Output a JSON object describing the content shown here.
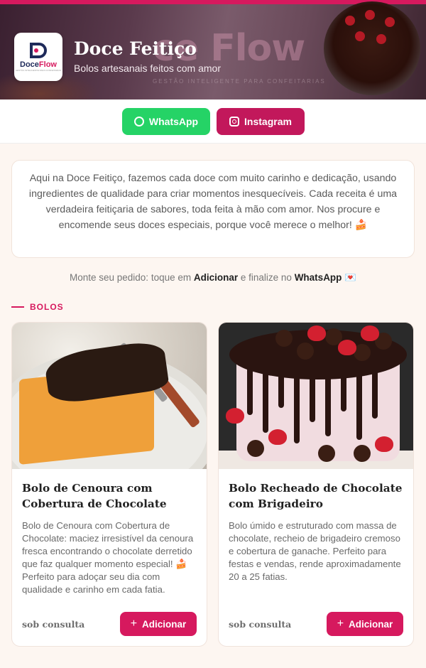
{
  "header": {
    "banner_watermark": "ce Flow",
    "banner_tagline": "GESTÃO INTELIGENTE PARA CONFEITARIAS",
    "logo_text_a": "Doce",
    "logo_text_b": "Flow",
    "logo_subtext": "GESTÃO INTELIGENTE PARA CONFEITARIAS",
    "brand_name": "Doce Feitiço",
    "brand_tagline": "Bolos artesanais feitos com amor"
  },
  "social": {
    "whatsapp_label": "WhatsApp",
    "instagram_label": "Instagram",
    "colors": {
      "whatsapp": "#25d366",
      "instagram": "#c2185b"
    }
  },
  "about": {
    "text": "Aqui na Doce Feitiço, fazemos cada doce com muito carinho e dedicação, usando ingredientes de qualidade para criar momentos inesquecíveis. Cada receita é uma verdadeira feitiçaria de sabores, toda feita à mão com amor. Nos procure e encomende seus doces especiais, porque você merece o melhor! 🍰"
  },
  "hint": {
    "prefix": "Monte seu pedido: toque em ",
    "add_word": "Adicionar",
    "middle": " e finalize no ",
    "wa_word": "WhatsApp",
    "suffix": " 💌"
  },
  "section": {
    "title": "BOLOS"
  },
  "products": [
    {
      "title": "Bolo de Cenoura com Cobertura de Chocolate",
      "description": "Bolo de Cenoura com Cobertura de Chocolate: maciez irresistível da cenoura fresca encontrando o chocolate derretido que faz qualquer momento especial! 🍰 Perfeito para adoçar seu dia com qualidade e carinho em cada fatia.",
      "price": "sob consulta",
      "add_label": "Adicionar",
      "plus_icon": "+"
    },
    {
      "title": "Bolo Recheado de Chocolate com Brigadeiro",
      "description": "Bolo úmido e estruturado com massa de chocolate, recheio de brigadeiro cremoso e cobertura de ganache. Perfeito para festas e vendas, rende aproximadamente 20 a 25 fatias.",
      "price": "sob consulta",
      "add_label": "Adicionar",
      "plus_icon": "+"
    }
  ],
  "accent_color": "#d6195e"
}
